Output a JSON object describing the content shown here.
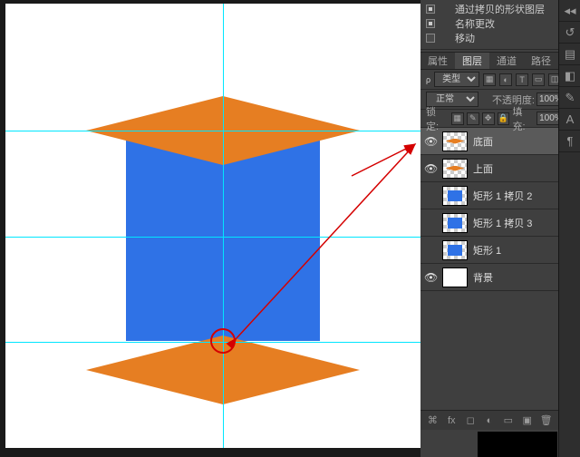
{
  "actions": [
    {
      "label": "通过拷贝的形状图层",
      "checked": true
    },
    {
      "label": "名称更改",
      "checked": true
    },
    {
      "label": "移动",
      "checked": false
    }
  ],
  "panel_tabs": {
    "properties": "属性",
    "layers": "图层",
    "channels": "通道",
    "paths": "路径"
  },
  "kind_label": "类型",
  "blend": {
    "mode": "正常",
    "opacity_label": "不透明度:",
    "opacity": "100%",
    "fill_label": "填充:",
    "fill": "100%"
  },
  "lock_label": "锁定:",
  "layers": [
    {
      "name": "底面",
      "visible": true,
      "thumb": "diamond",
      "selected": true
    },
    {
      "name": "上面",
      "visible": true,
      "thumb": "diamond"
    },
    {
      "name": "矩形 1 拷贝 2",
      "visible": false,
      "thumb": "square"
    },
    {
      "name": "矩形 1 拷贝 3",
      "visible": false,
      "thumb": "square"
    },
    {
      "name": "矩形 1",
      "visible": false,
      "thumb": "square"
    },
    {
      "name": "背景",
      "visible": true,
      "thumb": "bg",
      "locked": true
    }
  ]
}
